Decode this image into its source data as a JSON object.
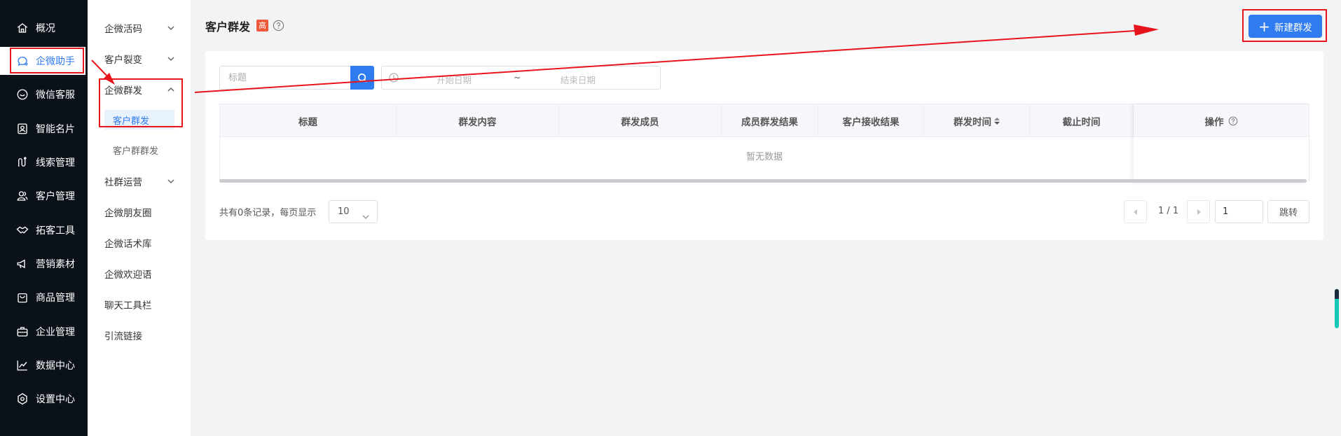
{
  "sidebar_primary": {
    "items": [
      {
        "label": "概况",
        "icon": "home-icon"
      },
      {
        "label": "企微助手",
        "icon": "chat-assistant-icon",
        "active": true
      },
      {
        "label": "微信客服",
        "icon": "headset-icon"
      },
      {
        "label": "智能名片",
        "icon": "id-card-icon"
      },
      {
        "label": "线索管理",
        "icon": "clue-icon"
      },
      {
        "label": "客户管理",
        "icon": "customers-icon"
      },
      {
        "label": "拓客工具",
        "icon": "handshake-icon"
      },
      {
        "label": "营销素材",
        "icon": "megaphone-icon"
      },
      {
        "label": "商品管理",
        "icon": "bag-icon"
      },
      {
        "label": "企业管理",
        "icon": "briefcase-icon"
      },
      {
        "label": "数据中心",
        "icon": "line-chart-icon"
      },
      {
        "label": "设置中心",
        "icon": "settings-icon"
      }
    ]
  },
  "sidebar_secondary": {
    "items": [
      {
        "label": "企微活码",
        "expandable": true
      },
      {
        "label": "客户裂变",
        "expandable": true
      },
      {
        "label": "企微群发",
        "expandable": true,
        "expanded": true
      },
      {
        "label": "客户群发",
        "sub": true,
        "active": true
      },
      {
        "label": "客户群群发",
        "sub": true
      },
      {
        "label": "社群运营",
        "expandable": true
      },
      {
        "label": "企微朋友圈"
      },
      {
        "label": "企微话术库"
      },
      {
        "label": "企微欢迎语"
      },
      {
        "label": "聊天工具栏"
      },
      {
        "label": "引流链接"
      }
    ]
  },
  "header": {
    "title": "客户群发",
    "badge": "高",
    "new_button": "新建群发"
  },
  "filters": {
    "title_placeholder": "标题",
    "date_start_placeholder": "开始日期",
    "date_separator": "~",
    "date_end_placeholder": "结束日期"
  },
  "table": {
    "columns": [
      "标题",
      "群发内容",
      "群发成员",
      "成员群发结果",
      "客户接收结果",
      "群发时间",
      "截止时间",
      "操作"
    ],
    "empty_text": "暂无数据"
  },
  "pagination": {
    "total_text": "共有0条记录，每页显示",
    "page_size": "10",
    "page_info": "1 / 1",
    "jump_value": "1",
    "jump_label": "跳转"
  },
  "colors": {
    "primary": "#2f7bf0",
    "sidebar_bg": "#0b1119",
    "annotation_red": "#e8141c",
    "badge": "#f05a3a"
  }
}
